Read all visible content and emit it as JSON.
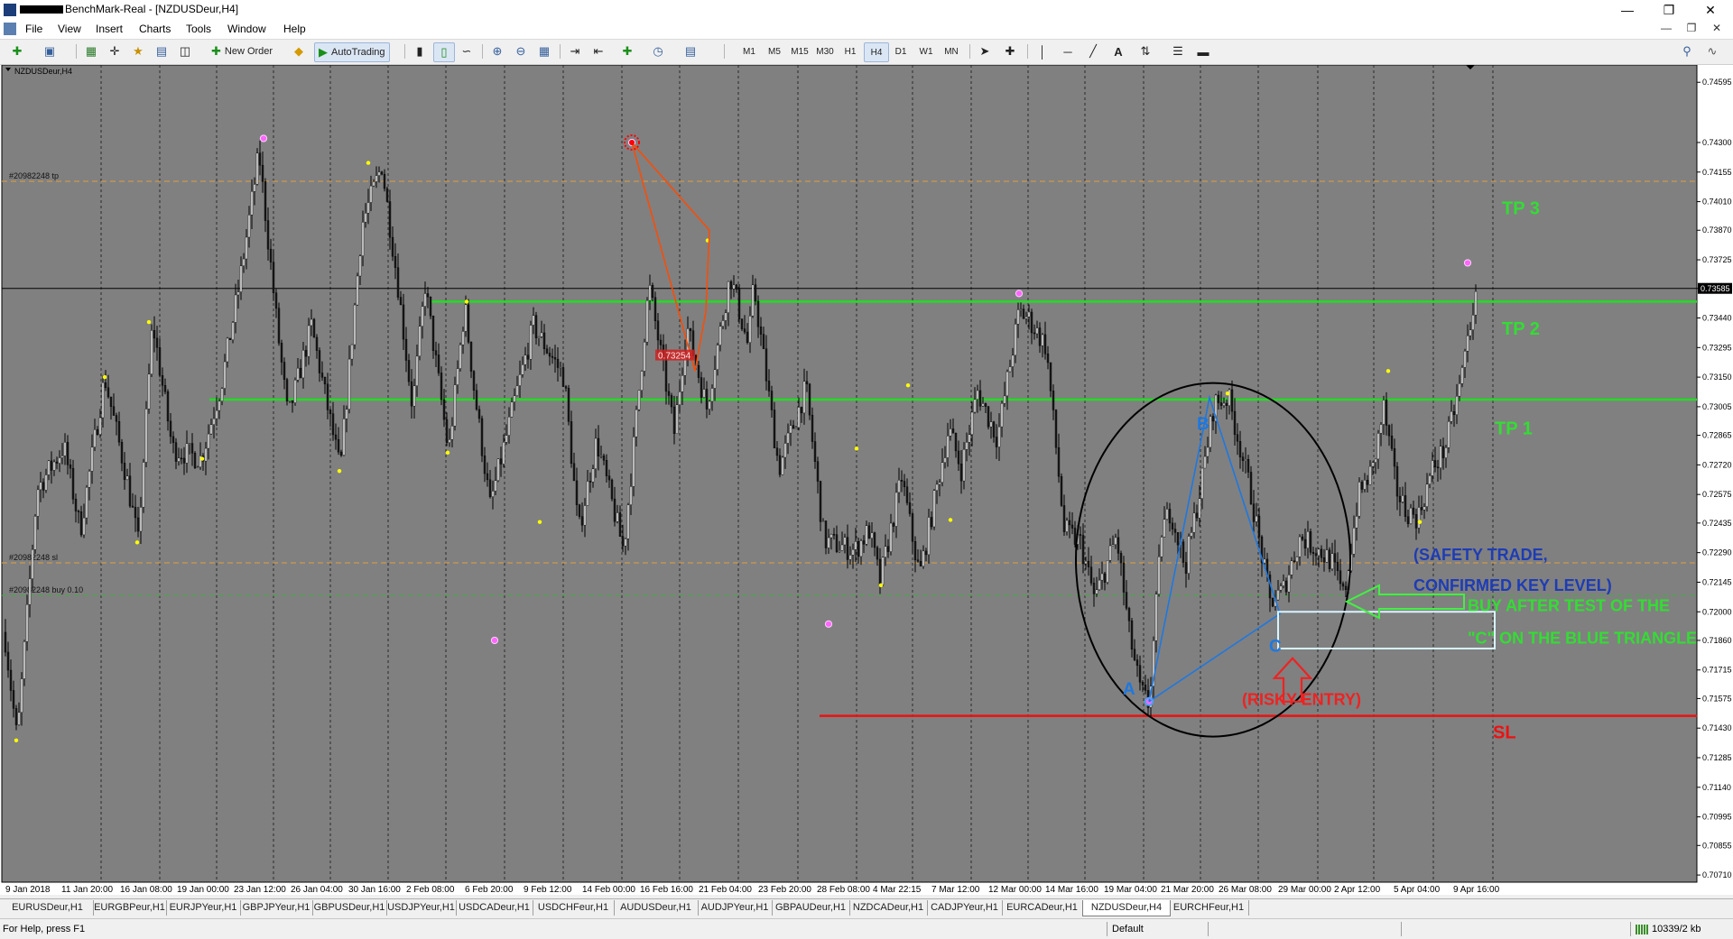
{
  "window": {
    "title": "BenchMark-Real - [NZDUSDeur,H4]",
    "buttons": [
      "—",
      "❐",
      "✕"
    ]
  },
  "menu": {
    "items": [
      "File",
      "View",
      "Insert",
      "Charts",
      "Tools",
      "Window",
      "Help"
    ],
    "mdi_buttons": [
      "—",
      "❐",
      "✕"
    ]
  },
  "toolbar": {
    "new_order": "New Order",
    "autotrading": "AutoTrading",
    "timeframes": [
      "M1",
      "M5",
      "M15",
      "M30",
      "H1",
      "H4",
      "D1",
      "W1",
      "MN"
    ],
    "active_timeframe": "H4"
  },
  "chart": {
    "symbol_label": "NZDUSDeur,H4",
    "background": "#808080",
    "bull_candle": "#e8e8e8",
    "bear_candle": "#1a1a1a",
    "price_labels": [
      "0.74595",
      "0.74300",
      "0.74155",
      "0.74010",
      "0.73870",
      "0.73725",
      "0.73585",
      "0.73440",
      "0.73295",
      "0.73150",
      "0.73005",
      "0.72865",
      "0.72720",
      "0.72575",
      "0.72435",
      "0.72290",
      "0.72145",
      "0.72000",
      "0.71860",
      "0.71715",
      "0.71575",
      "0.71430",
      "0.71285",
      "0.71140",
      "0.70995",
      "0.70855",
      "0.70710"
    ],
    "current_price": "0.73585",
    "time_labels": [
      "9 Jan 2018",
      "11 Jan 20:00",
      "16 Jan 08:00",
      "19 Jan 00:00",
      "23 Jan 12:00",
      "26 Jan 04:00",
      "30 Jan 16:00",
      "2 Feb 08:00",
      "6 Feb 20:00",
      "9 Feb 12:00",
      "14 Feb 00:00",
      "16 Feb 16:00",
      "21 Feb 04:00",
      "23 Feb 20:00",
      "28 Feb 08:00",
      "4 Mar 22:15",
      "7 Mar 12:00",
      "12 Mar 00:00",
      "14 Mar 16:00",
      "19 Mar 04:00",
      "21 Mar 20:00",
      "26 Mar 08:00",
      "29 Mar 00:00",
      "2 Apr 12:00",
      "5 Apr 04:00",
      "9 Apr 16:00"
    ],
    "order_labels": {
      "tp": "#20982248 tp",
      "sl": "#20982248 sl",
      "buy": "#20982248 buy 0.10"
    },
    "price_box": "0.73254",
    "annotations": {
      "tp3": "TP 3",
      "tp2": "TP 2",
      "tp1": "TP 1",
      "sl": "SL",
      "point_a": "A",
      "point_b": "B",
      "point_c": "C",
      "risky": "(RISKY ENTRY)",
      "safety_line1": "(SAFETY TRADE,",
      "safety_line2": "CONFIRMED KEY LEVEL)",
      "buy_line1": "BUY AFTER TEST OF THE",
      "buy_line2": "\"C\" ON THE BLUE TRIANGLE"
    },
    "colors": {
      "tp_line": "#22dd22",
      "sl_line": "#ee1111",
      "triangle": "#1e78e0",
      "zigzag": "#ff4a00",
      "annotation_blue": "#1e3cb4",
      "annotation_green": "#33dd33",
      "annotation_red": "#ee2222"
    }
  },
  "tabs": [
    "EURUSDeur,H1",
    "EURGBPeur,H1",
    "EURJPYeur,H1",
    "GBPJPYeur,H1",
    "GBPUSDeur,H1",
    "USDJPYeur,H1",
    "USDCADeur,H1",
    "USDCHFeur,H1",
    "AUDUSDeur,H1",
    "AUDJPYeur,H1",
    "GBPAUDeur,H1",
    "NZDCADeur,H1",
    "CADJPYeur,H1",
    "EURCADeur,H1",
    "NZDUSDeur,H4",
    "EURCHFeur,H1"
  ],
  "active_tab": "NZDUSDeur,H4",
  "status": {
    "help": "For Help, press F1",
    "profile": "Default",
    "connection": "10339/2 kb"
  }
}
